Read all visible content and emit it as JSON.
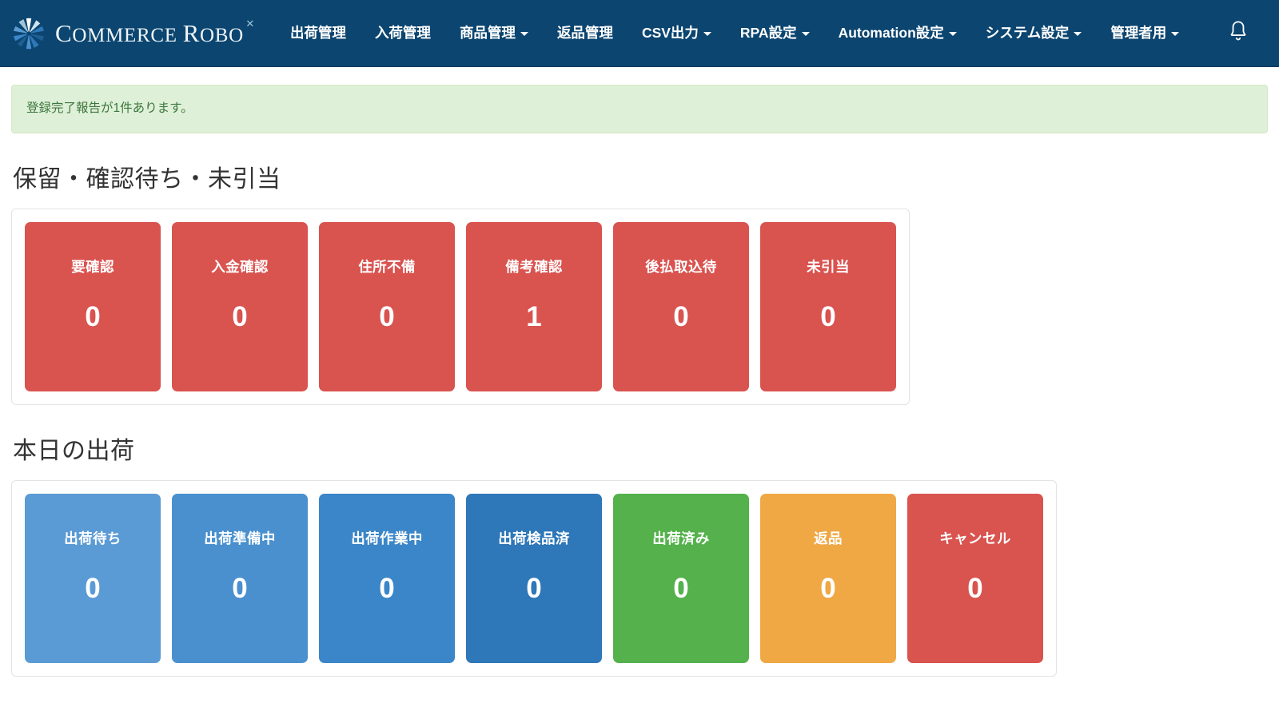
{
  "navbar": {
    "brand": {
      "logo_icon": "pinwheel-logo-icon",
      "text_first": "C",
      "text_rest": "OMMERCE ",
      "text_second_first": "R",
      "text_second_rest": "OBO",
      "star": "✕"
    },
    "items": [
      {
        "label": "出荷管理",
        "has_caret": false,
        "name": "nav-item-shipping"
      },
      {
        "label": "入荷管理",
        "has_caret": false,
        "name": "nav-item-receiving"
      },
      {
        "label": "商品管理",
        "has_caret": true,
        "name": "nav-item-products"
      },
      {
        "label": "返品管理",
        "has_caret": false,
        "name": "nav-item-returns"
      },
      {
        "label": "CSV出力",
        "has_caret": true,
        "name": "nav-item-csv-export"
      },
      {
        "label": "RPA設定",
        "has_caret": true,
        "name": "nav-item-rpa-settings"
      },
      {
        "label": "Automation設定",
        "has_caret": true,
        "name": "nav-item-automation-settings"
      },
      {
        "label": "システム設定",
        "has_caret": true,
        "name": "nav-item-system-settings"
      },
      {
        "label": "管理者用",
        "has_caret": true,
        "name": "nav-item-admin"
      }
    ],
    "notification_icon": "bell-icon",
    "background_color": "#0b4570"
  },
  "alert": {
    "message": "登録完了報告が1件あります。",
    "background_color": "#dff0d8",
    "text_color": "#3c763d"
  },
  "sections": [
    {
      "title": "保留・確認待ち・未引当",
      "name": "section-pending",
      "cards": [
        {
          "label": "要確認",
          "value": "0",
          "color": "#d9534f",
          "name": "card-requires-confirmation"
        },
        {
          "label": "入金確認",
          "value": "0",
          "color": "#d9534f",
          "name": "card-payment-confirmation"
        },
        {
          "label": "住所不備",
          "value": "0",
          "color": "#d9534f",
          "name": "card-address-incomplete"
        },
        {
          "label": "備考確認",
          "value": "1",
          "color": "#d9534f",
          "name": "card-remarks-confirmation"
        },
        {
          "label": "後払取込待",
          "value": "0",
          "color": "#d9534f",
          "name": "card-deferred-payment-import"
        },
        {
          "label": "未引当",
          "value": "0",
          "color": "#d9534f",
          "name": "card-unallocated"
        }
      ]
    },
    {
      "title": "本日の出荷",
      "name": "section-today-shipping",
      "cards": [
        {
          "label": "出荷待ち",
          "value": "0",
          "color": "#5b9bd5",
          "name": "card-awaiting-shipment"
        },
        {
          "label": "出荷準備中",
          "value": "0",
          "color": "#4a90cf",
          "name": "card-preparing-shipment"
        },
        {
          "label": "出荷作業中",
          "value": "0",
          "color": "#3a86c8",
          "name": "card-shipment-in-progress"
        },
        {
          "label": "出荷検品済",
          "value": "0",
          "color": "#2e77b8",
          "name": "card-shipment-inspected"
        },
        {
          "label": "出荷済み",
          "value": "0",
          "color": "#54b14c",
          "name": "card-shipped"
        },
        {
          "label": "返品",
          "value": "0",
          "color": "#efa844",
          "name": "card-returned"
        },
        {
          "label": "キャンセル",
          "value": "0",
          "color": "#d9534f",
          "name": "card-cancelled"
        }
      ]
    }
  ]
}
